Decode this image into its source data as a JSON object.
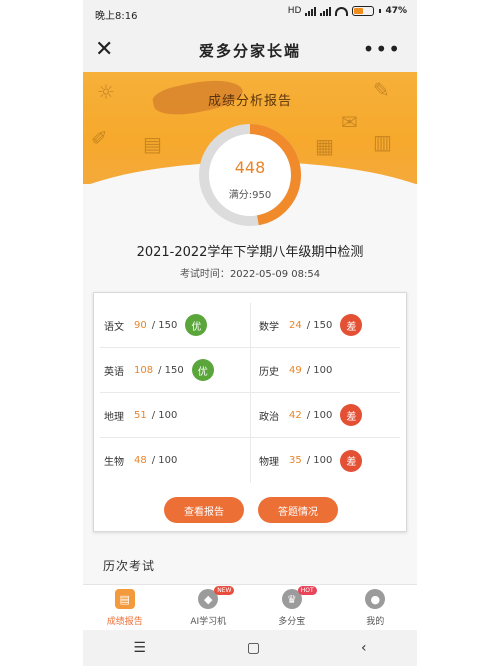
{
  "status_bar": {
    "time": "晚上8:16",
    "network": "HD",
    "battery": "47%",
    "battery_level": 0.47
  },
  "nav": {
    "title": "爱多分家长端",
    "close_icon": "close-icon",
    "more_icon": "more-icon"
  },
  "banner": {
    "title": "成绩分析报告"
  },
  "gauge": {
    "score": "448",
    "full_label": "满分:950",
    "score_value": 448,
    "full_value": 950
  },
  "exam": {
    "title": "2021-2022学年下学期八年级期中检测",
    "time_label": "考试时间：",
    "time_value": "2022-05-09 08:54"
  },
  "subjects": [
    {
      "name": "语文",
      "score": "90",
      "total": "/ 150",
      "badge": "优",
      "badge_color": "#5aa63b"
    },
    {
      "name": "数学",
      "score": "24",
      "total": "/ 150",
      "badge": "差",
      "badge_color": "#e45034"
    },
    {
      "name": "英语",
      "score": "108",
      "total": "/ 150",
      "badge": "优",
      "badge_color": "#5aa63b"
    },
    {
      "name": "历史",
      "score": "49",
      "total": "/ 100",
      "badge": "",
      "badge_color": ""
    },
    {
      "name": "地理",
      "score": "51",
      "total": "/ 100",
      "badge": "",
      "badge_color": ""
    },
    {
      "name": "政治",
      "score": "42",
      "total": "/ 100",
      "badge": "差",
      "badge_color": "#e45034"
    },
    {
      "name": "生物",
      "score": "48",
      "total": "/ 100",
      "badge": "",
      "badge_color": ""
    },
    {
      "name": "物理",
      "score": "35",
      "total": "/ 100",
      "badge": "差",
      "badge_color": "#e45034"
    }
  ],
  "buttons": {
    "view_report": "查看报告",
    "study_status": "答题情况"
  },
  "history": {
    "title": "历次考试"
  },
  "tabs": [
    {
      "label": "成绩报告",
      "icon": "report-icon",
      "active": true,
      "tag": ""
    },
    {
      "label": "AI学习机",
      "icon": "diamond-icon",
      "active": false,
      "tag": "NEW"
    },
    {
      "label": "多分宝",
      "icon": "crown-icon",
      "active": false,
      "tag": "HOT"
    },
    {
      "label": "我的",
      "icon": "user-icon",
      "active": false,
      "tag": ""
    }
  ],
  "colors": {
    "accent": "#ec6f36",
    "banner": "#f6a92c",
    "good": "#5aa63b",
    "bad": "#e45034"
  }
}
